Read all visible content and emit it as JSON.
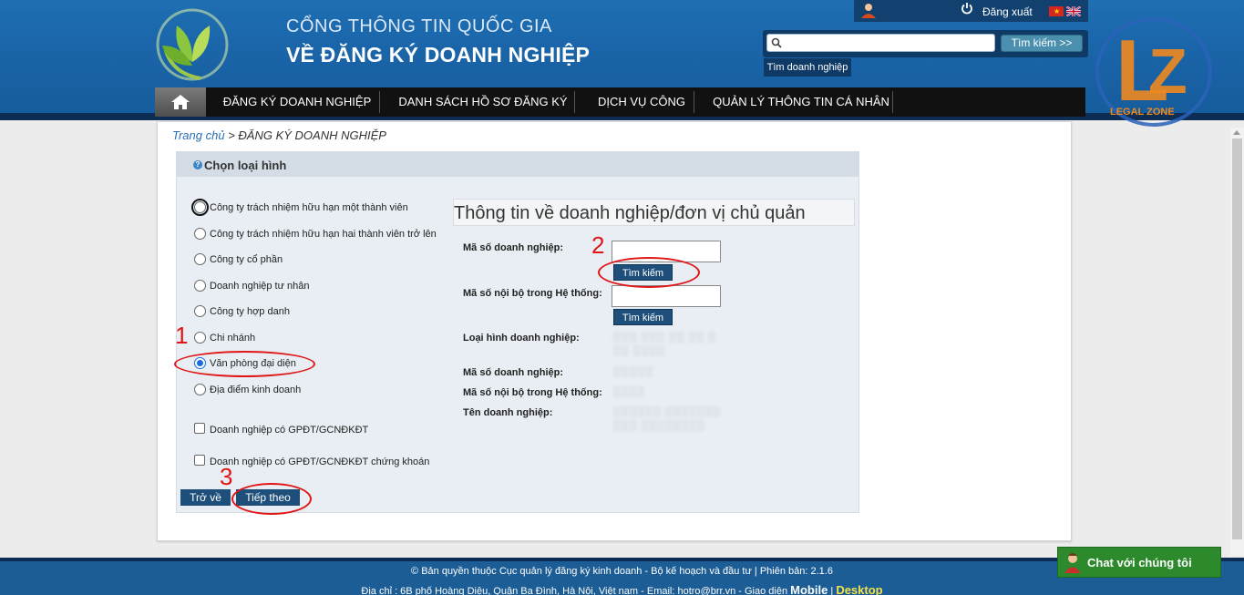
{
  "header": {
    "title_top": "CỔNG THÔNG TIN QUỐC GIA",
    "title_main": "VỀ ĐĂNG KÝ DOANH NGHIỆP",
    "logout_label": "Đăng xuất",
    "search_placeholder": "",
    "search_button": "Tìm kiếm >>",
    "search_tab": "Tìm doanh nghiệp"
  },
  "nav": {
    "items": [
      {
        "label": "ĐĂNG KÝ DOANH NGHIỆP"
      },
      {
        "label": "DANH SÁCH HỒ SƠ ĐĂNG KÝ"
      },
      {
        "label": "DỊCH VỤ CÔNG"
      },
      {
        "label": "QUẢN LÝ THÔNG TIN CÁ NHÂN"
      }
    ]
  },
  "lz_logo": {
    "letters": "LZ",
    "caption": "LEGAL ZONE"
  },
  "breadcrumb": {
    "home": "Trang chủ",
    "separator": ">",
    "current": "ĐĂNG KÝ DOANH NGHIỆP"
  },
  "form": {
    "title": "Chọn loại hình",
    "options": [
      {
        "label": "Công ty trách nhiệm hữu hạn một thành viên",
        "type": "radio",
        "checked": false
      },
      {
        "label": "Công ty trách nhiệm hữu hạn hai thành viên trở lên",
        "type": "radio",
        "checked": false
      },
      {
        "label": "Công ty cổ phần",
        "type": "radio",
        "checked": false
      },
      {
        "label": "Doanh nghiệp tư nhân",
        "type": "radio",
        "checked": false
      },
      {
        "label": "Công ty hợp danh",
        "type": "radio",
        "checked": false
      },
      {
        "label": "Chi nhánh",
        "type": "radio",
        "checked": false
      },
      {
        "label": "Văn phòng đại diện",
        "type": "radio",
        "checked": true
      },
      {
        "label": "Địa điểm kinh doanh",
        "type": "radio",
        "checked": false
      },
      {
        "label": "Doanh nghiệp có GPĐT/GCNĐKĐT",
        "type": "checkbox",
        "checked": false
      },
      {
        "label": "Doanh nghiệp có GPĐT/GCNĐKĐT chứng khoán",
        "type": "checkbox",
        "checked": false
      }
    ],
    "back_button": "Trở về",
    "next_button": "Tiếp theo"
  },
  "info": {
    "title": "Thông tin về doanh nghiệp/đơn vị chủ quản",
    "tax_code_label": "Mã số doanh nghiệp:",
    "internal_code_label": "Mã số nội bộ trong Hệ thống:",
    "find_button": "Tìm kiếm",
    "result_type_label": "Loại hình doanh nghiệp:",
    "result_tax_label": "Mã số doanh nghiệp:",
    "result_internal_label": "Mã số nội bộ trong Hệ thống:",
    "result_name_label": "Tên doanh nghiệp:",
    "tax_code_value": "",
    "internal_code_value": ""
  },
  "annotations": {
    "step1": "1",
    "step2": "2",
    "step3": "3"
  },
  "footer": {
    "line1": "© Bản quyền thuộc Cục quản lý đăng ký kinh doanh - Bộ kế hoạch và đầu tư | Phiên bản: 2.1.6",
    "line2": "Địa chỉ : 6B phố Hoàng Diệu, Quận Ba Đình, Hà Nội, Việt nam - Email: hotro@brr.vn - Giao diện",
    "mobile": "Mobile",
    "sep": "|",
    "desktop": "Desktop"
  },
  "chat": {
    "label": "Chat với chúng tôi"
  },
  "colors": {
    "header_blue": "#1a64a8",
    "button_navy": "#1d4f7a",
    "annotation_red": "#e01616",
    "chat_green": "#2c8a2c"
  }
}
